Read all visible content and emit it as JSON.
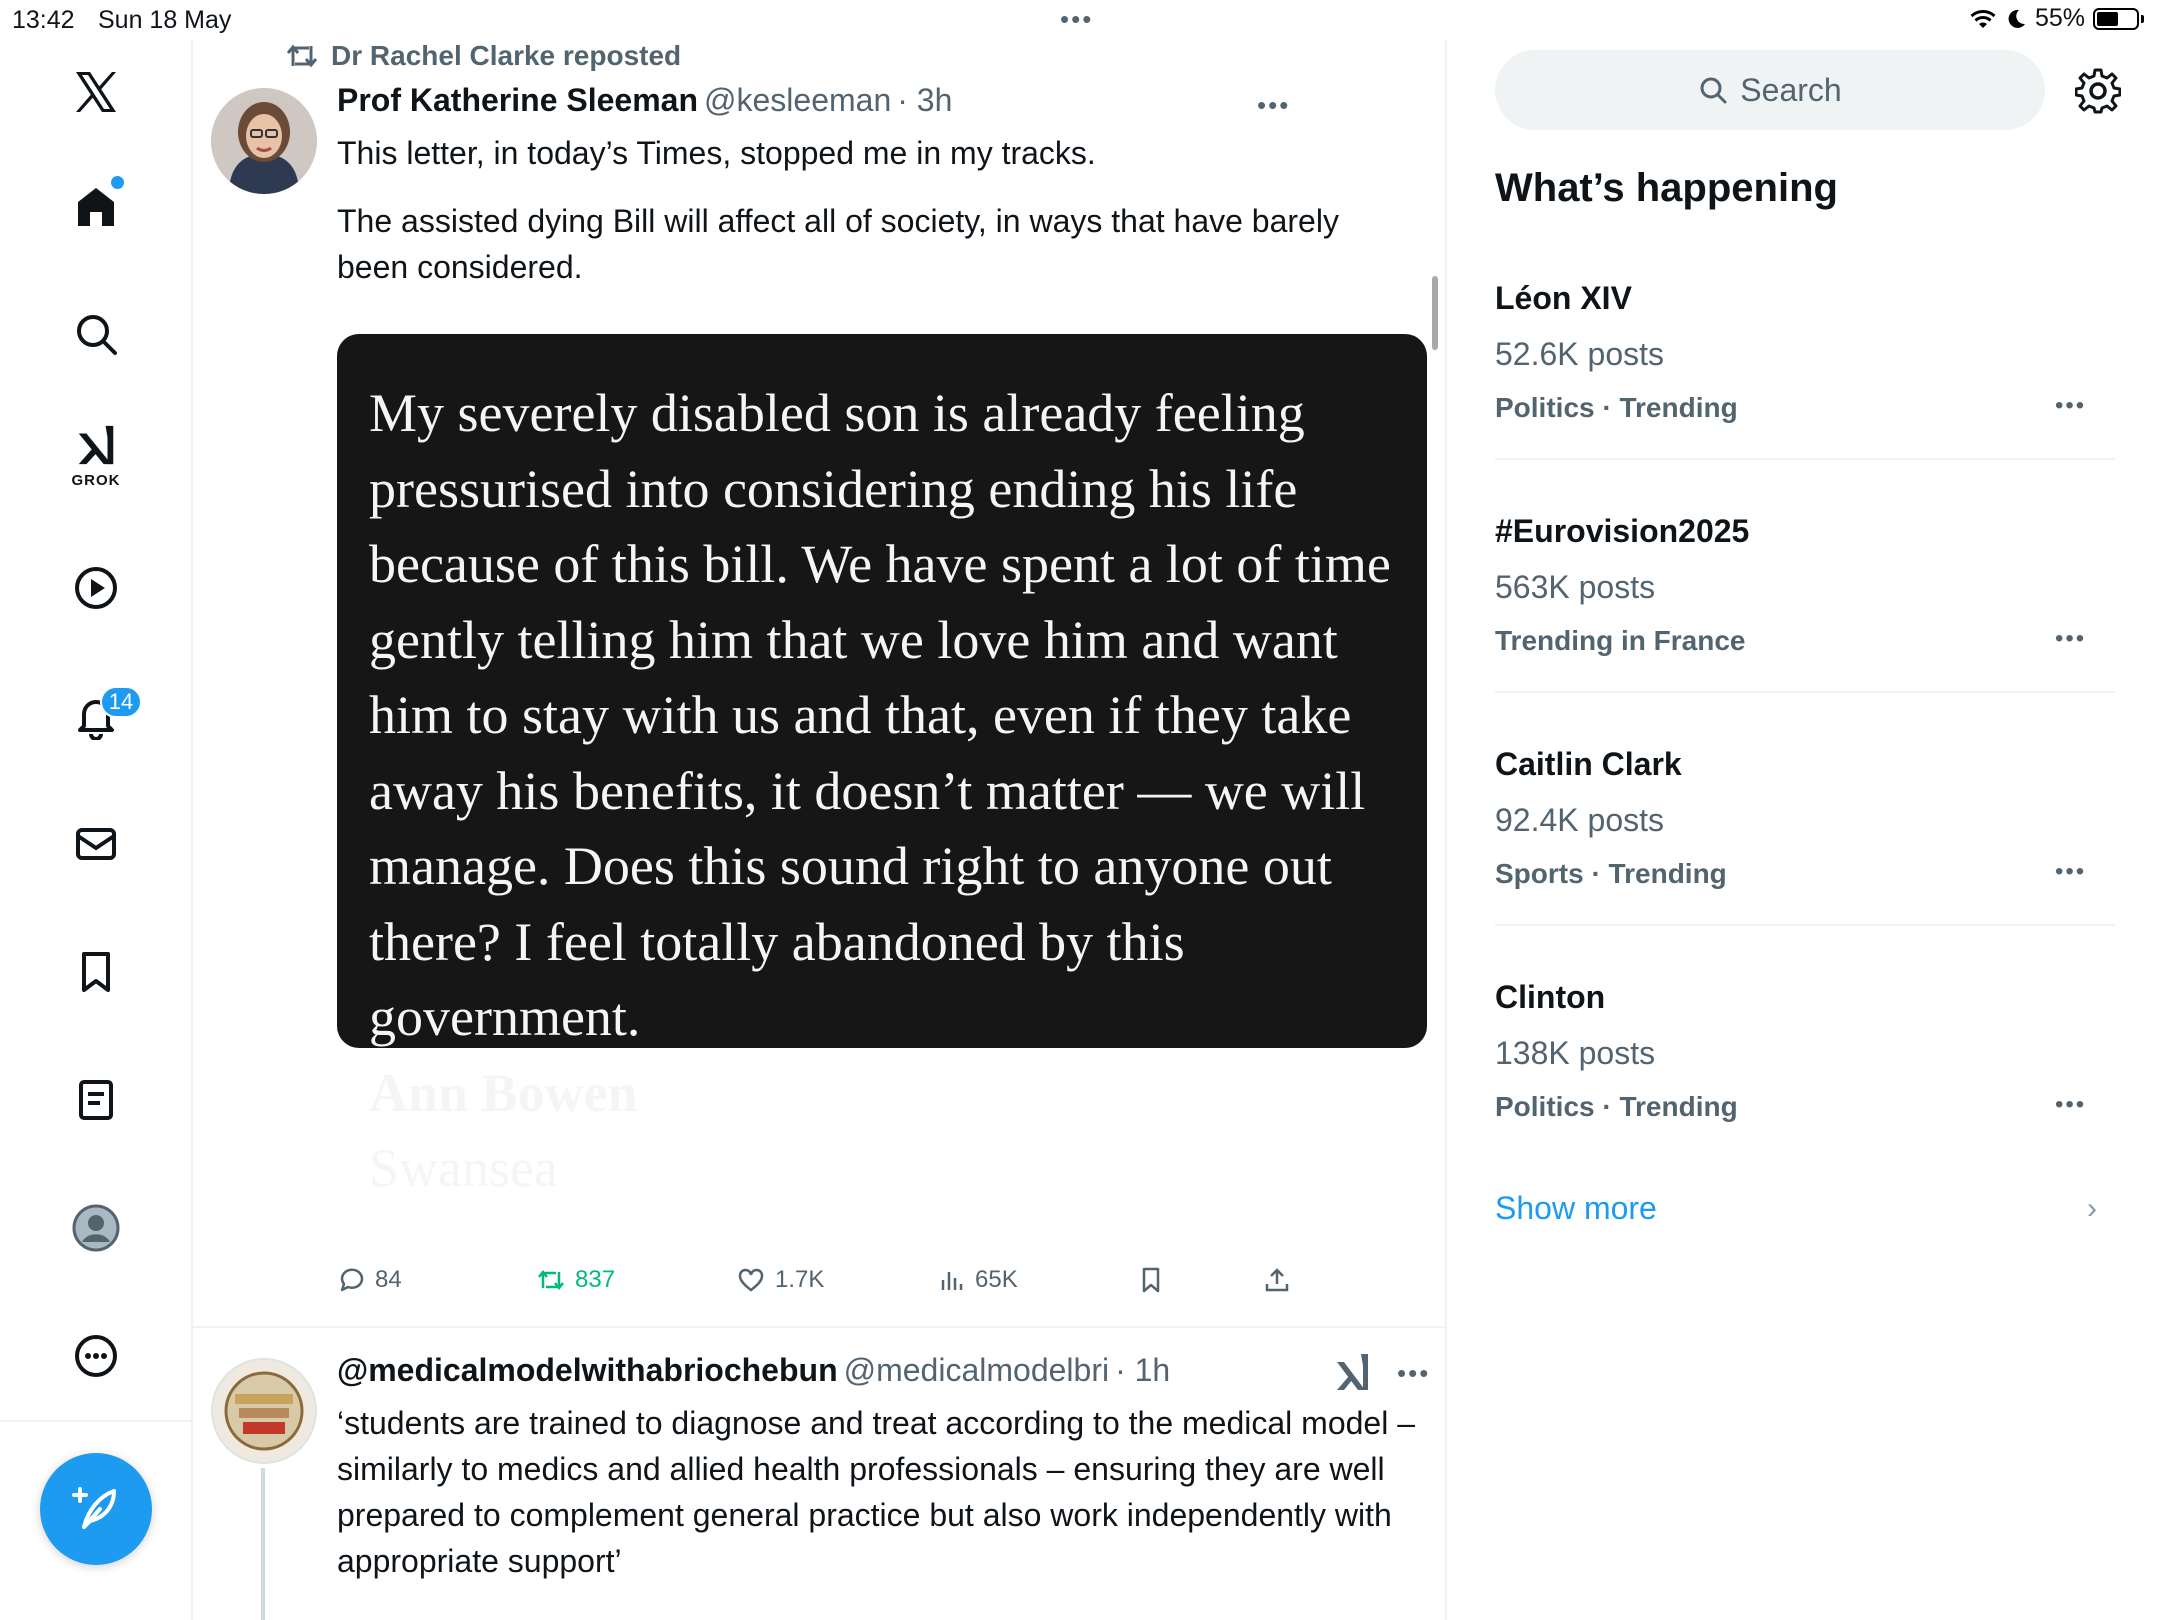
{
  "status_bar": {
    "time": "13:42",
    "date": "Sun 18 May",
    "battery": "55%",
    "battery_level": 0.55,
    "dots": "•••"
  },
  "nav": {
    "grok_label": "GROK",
    "notifications_count": "14",
    "items": [
      "x-logo-icon",
      "home-icon",
      "search-icon",
      "grok-icon",
      "video-icon",
      "bell-icon",
      "mail-icon",
      "bookmark-icon",
      "lists-icon",
      "profile-icon",
      "more-icon"
    ]
  },
  "post1": {
    "repost_by": "Dr Rachel Clarke reposted",
    "author_name": "Prof Katherine Sleeman",
    "author_handle": "@kesleeman",
    "time": "· 3h",
    "more": "•••",
    "text_line1": "This letter, in today’s Times, stopped me in my tracks.",
    "text_line2": "The assisted dying Bill will affect all of society, in ways that have barely been considered.",
    "letter_body": "My severely disabled son is already feeling pressurised into considering ending his life because of this bill. We have spent a lot of time gently telling him that we love him and want him to stay with us and that, even if they take away his benefits, it doesn’t matter — we will manage. Does this sound right to anyone out there? I feel totally abandoned by this government.",
    "letter_author": "Ann Bowen",
    "letter_place": "Swansea",
    "replies": "84",
    "reposts": "837",
    "likes": "1.7K",
    "views": "65K"
  },
  "post2": {
    "author_name": "@medicalmodelwithabriochebun",
    "author_handle": "@medicalmodelbri",
    "time": "· 1h",
    "more": "•••",
    "text": "‘students are trained to diagnose and treat according to the medical model – similarly to medics and allied health professionals – ensuring they are well prepared to complement general practice but also work independently with appropriate support’"
  },
  "sidebar": {
    "search_placeholder": "Search",
    "whats_happening": "What’s happening",
    "trends": [
      {
        "name": "Léon XIV",
        "count": "52.6K posts",
        "category": "Politics · Trending"
      },
      {
        "name": "#Eurovision2025",
        "count": "563K posts",
        "category": "Trending in France"
      },
      {
        "name": "Caitlin Clark",
        "count": "92.4K posts",
        "category": "Sports · Trending"
      },
      {
        "name": "Clinton",
        "count": "138K posts",
        "category": "Politics · Trending"
      }
    ],
    "more_dots": "•••",
    "show_more": "Show more",
    "chevron": "›"
  },
  "colors": {
    "accent": "#1d9bf0",
    "repost_green": "#00ba7c",
    "muted_text": "#536471",
    "letter_bg": "#161616"
  }
}
